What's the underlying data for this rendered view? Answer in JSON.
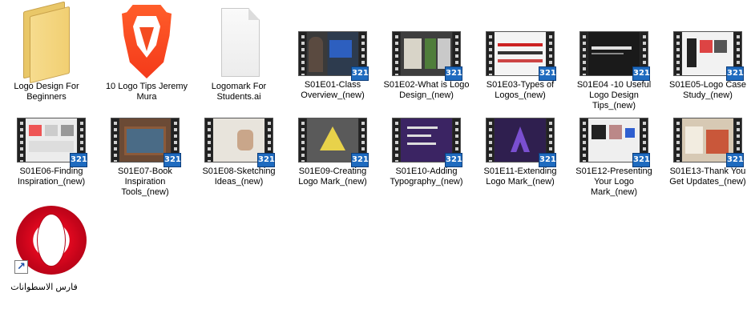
{
  "desktop": {
    "row1": [
      {
        "name": "folder-logo-design",
        "type": "folder",
        "label": "Logo Design For Beginners"
      },
      {
        "name": "brave-shortcut",
        "type": "brave",
        "label": "10 Logo Tips Jeremy Mura"
      },
      {
        "name": "ai-file",
        "type": "document",
        "label": "Logomark For Students.ai"
      },
      {
        "name": "video-s01e01",
        "type": "video",
        "label": "S01E01-Class Overview_(new)"
      },
      {
        "name": "video-s01e02",
        "type": "video",
        "label": "S01E02-What is Logo Design_(new)"
      },
      {
        "name": "video-s01e03",
        "type": "video",
        "label": "S01E03-Types of Logos_(new)"
      },
      {
        "name": "video-s01e04",
        "type": "video",
        "label": "S01E04 -10 Useful Logo Design Tips_(new)"
      },
      {
        "name": "video-s01e05",
        "type": "video",
        "label": "S01E05-Logo Case Study_(new)"
      }
    ],
    "row2": [
      {
        "name": "video-s01e06",
        "type": "video",
        "label": "S01E06-Finding Inspiration_(new)"
      },
      {
        "name": "video-s01e07",
        "type": "video",
        "label": "S01E07-Book Inspiration Tools_(new)"
      },
      {
        "name": "video-s01e08",
        "type": "video",
        "label": "S01E08-Sketching Ideas_(new)"
      },
      {
        "name": "video-s01e09",
        "type": "video",
        "label": "S01E09-Creating Logo Mark_(new)"
      },
      {
        "name": "video-s01e10",
        "type": "video",
        "label": "S01E10-Adding Typography_(new)"
      },
      {
        "name": "video-s01e11",
        "type": "video",
        "label": "S01E11-Extending Logo Mark_(new)"
      },
      {
        "name": "video-s01e12",
        "type": "video",
        "label": "S01E12-Presenting Your Logo Mark_(new)"
      },
      {
        "name": "video-s01e13",
        "type": "video",
        "label": "S01E13-Thank You Get Updates_(new)"
      }
    ],
    "row3": [
      {
        "name": "opera-shortcut",
        "type": "opera",
        "label": "فارس الاسطوانات"
      }
    ]
  },
  "video_badge": "321",
  "shortcut_arrow": "↗",
  "colors": {
    "background": "#ffffff",
    "badge": "#1f6bbf",
    "brave": "#f43a1a",
    "opera": "#e0081f",
    "folder": "#f1cf72"
  }
}
